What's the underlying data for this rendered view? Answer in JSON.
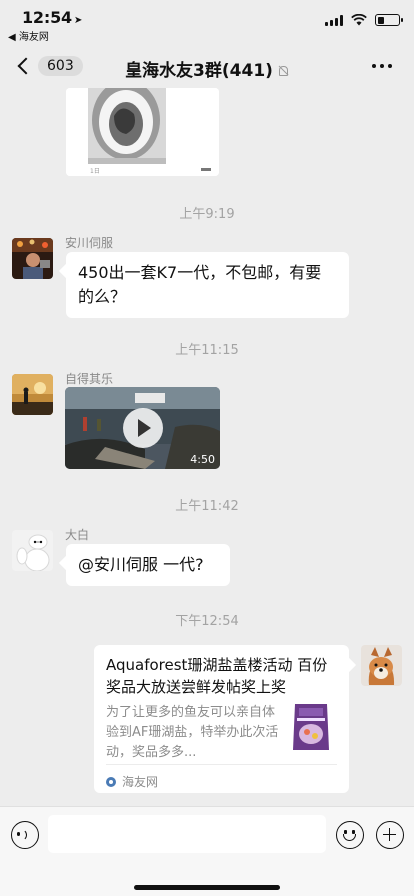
{
  "status_bar": {
    "time": "12:54",
    "back_app": "◀ 海友网"
  },
  "nav": {
    "unread_count": "603",
    "title": "皇海水友3群(441)"
  },
  "messages": [
    {
      "type": "image",
      "caption": "1日",
      "icon": "toilet-photo"
    },
    {
      "type": "timestamp",
      "text": "上午9:19"
    },
    {
      "type": "text",
      "sender": "安川伺服",
      "text": "450出一套K7一代，不包邮，有要的么？"
    },
    {
      "type": "timestamp",
      "text": "上午11:15"
    },
    {
      "type": "video",
      "sender": "自得其乐",
      "duration": "4:50"
    },
    {
      "type": "timestamp",
      "text": "上午11:42"
    },
    {
      "type": "text",
      "sender": "大白",
      "text": "@安川伺服 一代?"
    },
    {
      "type": "timestamp",
      "text": "下午12:54"
    },
    {
      "type": "link",
      "title": "Aquaforest珊湖盐盖楼活动 百份奖品大放送尝鲜发帖奖上奖",
      "description": "为了让更多的鱼友可以亲自体验到AF珊湖盐，特举办此次活动，奖品多多...",
      "source": "海友网"
    }
  ],
  "icons": {
    "back": "chevron-left-icon",
    "mute": "bell-slash-icon",
    "more": "more-dots-icon",
    "voice": "voice-icon",
    "emoji": "emoji-icon",
    "plus": "plus-icon"
  },
  "colors": {
    "background": "#ededed",
    "bubble": "#ffffff",
    "timestamp": "#a3a3a3"
  }
}
